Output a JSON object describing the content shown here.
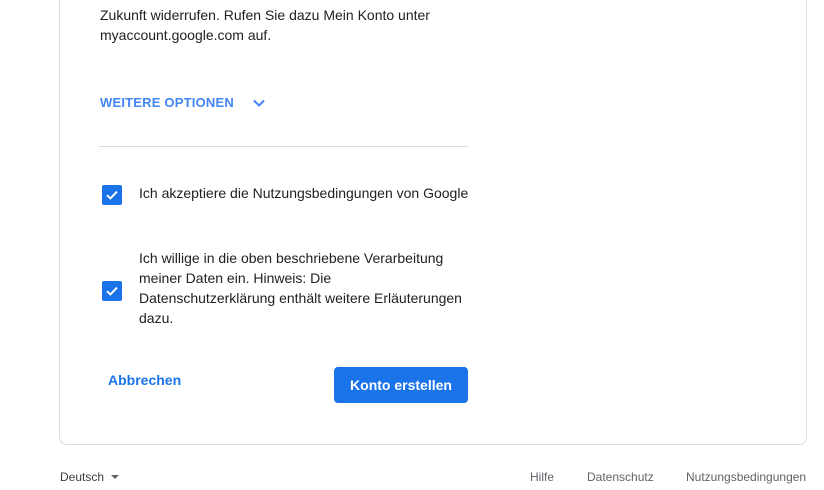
{
  "consent": {
    "paragraph_lines": [
      "Zukunft widerrufen. Rufen Sie dazu Mein Konto unter",
      "myaccount.google.com auf."
    ],
    "more_options_label": "WEITERE OPTIONEN",
    "terms_checkbox": {
      "label": "Ich akzeptiere die Nutzungsbedingungen von Google",
      "checked": true
    },
    "processing_checkbox": {
      "label_lines": [
        "Ich willige in die oben beschriebene Verarbeitung",
        "meiner Daten ein. Hinweis: Die",
        "Datenschutzerklärung enthält weitere Erläuterungen",
        "dazu."
      ],
      "checked": true
    }
  },
  "actions": {
    "cancel_label": "Abbrechen",
    "create_label": "Konto erstellen"
  },
  "footer": {
    "language": "Deutsch",
    "links": [
      "Hilfe",
      "Datenschutz",
      "Nutzungsbedingungen"
    ]
  },
  "colors": {
    "accent": "#1a73e8",
    "link_light": "#4285f4",
    "border": "#dadce0"
  },
  "icons": {
    "more_options": "chevron-down-icon",
    "checkbox": "check-icon",
    "language": "caret-down-icon"
  }
}
